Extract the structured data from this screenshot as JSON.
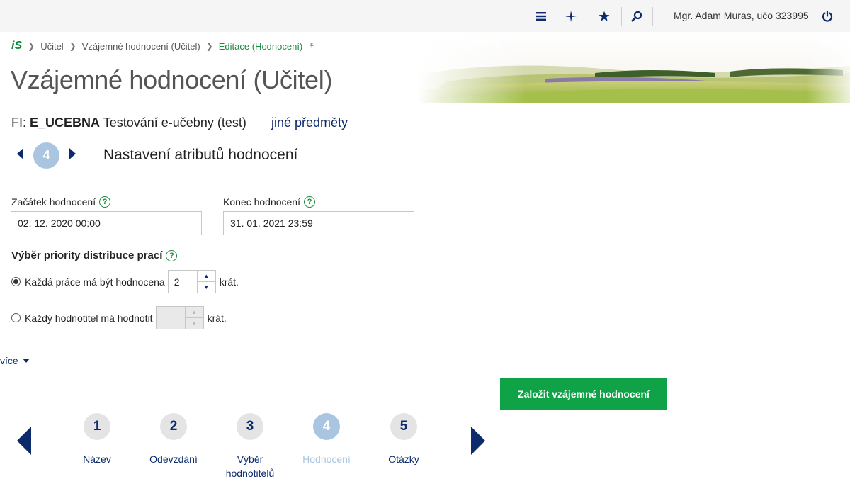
{
  "topbar": {
    "user": "Mgr. Adam Muras, učo 323995",
    "icons": [
      "menu-icon",
      "pin-navigation-icon",
      "star-icon",
      "search-icon",
      "power-icon"
    ]
  },
  "breadcrumb": {
    "logo": "iS",
    "items": [
      "Učitel",
      "Vzájemné hodnocení (Učitel)"
    ],
    "current": "Editace (Hodnocení)"
  },
  "page": {
    "title": "Vzájemné hodnocení (Učitel)",
    "course_prefix": "FI:",
    "course_code": "E_UCEBNA",
    "course_name": "Testování e-učebny (test)",
    "other_subjects": "jiné předměty"
  },
  "step_header": {
    "number": "4",
    "title": "Nastavení atributů hodnocení"
  },
  "form": {
    "start_label": "Začátek hodnocení",
    "start_value": "02. 12. 2020 00:00",
    "end_label": "Konec hodnocení",
    "end_value": "31. 01. 2021 23:59",
    "priority_label": "Výběr priority distribuce prací",
    "option1_label": "Každá práce má být hodnocena",
    "option1_value": "2",
    "option1_suffix": "krát.",
    "option2_label": "Každý hodnotitel má hodnotit",
    "option2_value": "",
    "option2_suffix": "krát.",
    "selected_option": 1,
    "more": "více",
    "help_glyph": "?"
  },
  "submit": {
    "label": "Založit vzájemné hodnocení"
  },
  "stepper": {
    "current": 4,
    "steps": [
      {
        "n": "1",
        "label": "Název"
      },
      {
        "n": "2",
        "label": "Odevzdání"
      },
      {
        "n": "3",
        "label": "Výběr hodnotitelů"
      },
      {
        "n": "4",
        "label": "Hodnocení"
      },
      {
        "n": "5",
        "label": "Otázky"
      }
    ]
  },
  "colors": {
    "accent": "#0c2a6c",
    "green": "#0fa247",
    "step_current": "#a9c5df"
  }
}
